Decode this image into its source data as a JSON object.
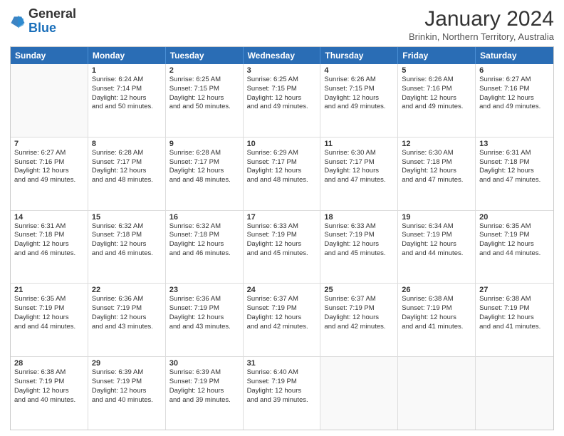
{
  "logo": {
    "line1": "General",
    "line2": "Blue"
  },
  "title": "January 2024",
  "subtitle": "Brinkin, Northern Territory, Australia",
  "header_days": [
    "Sunday",
    "Monday",
    "Tuesday",
    "Wednesday",
    "Thursday",
    "Friday",
    "Saturday"
  ],
  "weeks": [
    [
      {
        "day": "",
        "sunrise": "",
        "sunset": "",
        "daylight": ""
      },
      {
        "day": "1",
        "sunrise": "Sunrise: 6:24 AM",
        "sunset": "Sunset: 7:14 PM",
        "daylight": "Daylight: 12 hours and 50 minutes."
      },
      {
        "day": "2",
        "sunrise": "Sunrise: 6:25 AM",
        "sunset": "Sunset: 7:15 PM",
        "daylight": "Daylight: 12 hours and 50 minutes."
      },
      {
        "day": "3",
        "sunrise": "Sunrise: 6:25 AM",
        "sunset": "Sunset: 7:15 PM",
        "daylight": "Daylight: 12 hours and 49 minutes."
      },
      {
        "day": "4",
        "sunrise": "Sunrise: 6:26 AM",
        "sunset": "Sunset: 7:15 PM",
        "daylight": "Daylight: 12 hours and 49 minutes."
      },
      {
        "day": "5",
        "sunrise": "Sunrise: 6:26 AM",
        "sunset": "Sunset: 7:16 PM",
        "daylight": "Daylight: 12 hours and 49 minutes."
      },
      {
        "day": "6",
        "sunrise": "Sunrise: 6:27 AM",
        "sunset": "Sunset: 7:16 PM",
        "daylight": "Daylight: 12 hours and 49 minutes."
      }
    ],
    [
      {
        "day": "7",
        "sunrise": "Sunrise: 6:27 AM",
        "sunset": "Sunset: 7:16 PM",
        "daylight": "Daylight: 12 hours and 49 minutes."
      },
      {
        "day": "8",
        "sunrise": "Sunrise: 6:28 AM",
        "sunset": "Sunset: 7:17 PM",
        "daylight": "Daylight: 12 hours and 48 minutes."
      },
      {
        "day": "9",
        "sunrise": "Sunrise: 6:28 AM",
        "sunset": "Sunset: 7:17 PM",
        "daylight": "Daylight: 12 hours and 48 minutes."
      },
      {
        "day": "10",
        "sunrise": "Sunrise: 6:29 AM",
        "sunset": "Sunset: 7:17 PM",
        "daylight": "Daylight: 12 hours and 48 minutes."
      },
      {
        "day": "11",
        "sunrise": "Sunrise: 6:30 AM",
        "sunset": "Sunset: 7:17 PM",
        "daylight": "Daylight: 12 hours and 47 minutes."
      },
      {
        "day": "12",
        "sunrise": "Sunrise: 6:30 AM",
        "sunset": "Sunset: 7:18 PM",
        "daylight": "Daylight: 12 hours and 47 minutes."
      },
      {
        "day": "13",
        "sunrise": "Sunrise: 6:31 AM",
        "sunset": "Sunset: 7:18 PM",
        "daylight": "Daylight: 12 hours and 47 minutes."
      }
    ],
    [
      {
        "day": "14",
        "sunrise": "Sunrise: 6:31 AM",
        "sunset": "Sunset: 7:18 PM",
        "daylight": "Daylight: 12 hours and 46 minutes."
      },
      {
        "day": "15",
        "sunrise": "Sunrise: 6:32 AM",
        "sunset": "Sunset: 7:18 PM",
        "daylight": "Daylight: 12 hours and 46 minutes."
      },
      {
        "day": "16",
        "sunrise": "Sunrise: 6:32 AM",
        "sunset": "Sunset: 7:18 PM",
        "daylight": "Daylight: 12 hours and 46 minutes."
      },
      {
        "day": "17",
        "sunrise": "Sunrise: 6:33 AM",
        "sunset": "Sunset: 7:19 PM",
        "daylight": "Daylight: 12 hours and 45 minutes."
      },
      {
        "day": "18",
        "sunrise": "Sunrise: 6:33 AM",
        "sunset": "Sunset: 7:19 PM",
        "daylight": "Daylight: 12 hours and 45 minutes."
      },
      {
        "day": "19",
        "sunrise": "Sunrise: 6:34 AM",
        "sunset": "Sunset: 7:19 PM",
        "daylight": "Daylight: 12 hours and 44 minutes."
      },
      {
        "day": "20",
        "sunrise": "Sunrise: 6:35 AM",
        "sunset": "Sunset: 7:19 PM",
        "daylight": "Daylight: 12 hours and 44 minutes."
      }
    ],
    [
      {
        "day": "21",
        "sunrise": "Sunrise: 6:35 AM",
        "sunset": "Sunset: 7:19 PM",
        "daylight": "Daylight: 12 hours and 44 minutes."
      },
      {
        "day": "22",
        "sunrise": "Sunrise: 6:36 AM",
        "sunset": "Sunset: 7:19 PM",
        "daylight": "Daylight: 12 hours and 43 minutes."
      },
      {
        "day": "23",
        "sunrise": "Sunrise: 6:36 AM",
        "sunset": "Sunset: 7:19 PM",
        "daylight": "Daylight: 12 hours and 43 minutes."
      },
      {
        "day": "24",
        "sunrise": "Sunrise: 6:37 AM",
        "sunset": "Sunset: 7:19 PM",
        "daylight": "Daylight: 12 hours and 42 minutes."
      },
      {
        "day": "25",
        "sunrise": "Sunrise: 6:37 AM",
        "sunset": "Sunset: 7:19 PM",
        "daylight": "Daylight: 12 hours and 42 minutes."
      },
      {
        "day": "26",
        "sunrise": "Sunrise: 6:38 AM",
        "sunset": "Sunset: 7:19 PM",
        "daylight": "Daylight: 12 hours and 41 minutes."
      },
      {
        "day": "27",
        "sunrise": "Sunrise: 6:38 AM",
        "sunset": "Sunset: 7:19 PM",
        "daylight": "Daylight: 12 hours and 41 minutes."
      }
    ],
    [
      {
        "day": "28",
        "sunrise": "Sunrise: 6:38 AM",
        "sunset": "Sunset: 7:19 PM",
        "daylight": "Daylight: 12 hours and 40 minutes."
      },
      {
        "day": "29",
        "sunrise": "Sunrise: 6:39 AM",
        "sunset": "Sunset: 7:19 PM",
        "daylight": "Daylight: 12 hours and 40 minutes."
      },
      {
        "day": "30",
        "sunrise": "Sunrise: 6:39 AM",
        "sunset": "Sunset: 7:19 PM",
        "daylight": "Daylight: 12 hours and 39 minutes."
      },
      {
        "day": "31",
        "sunrise": "Sunrise: 6:40 AM",
        "sunset": "Sunset: 7:19 PM",
        "daylight": "Daylight: 12 hours and 39 minutes."
      },
      {
        "day": "",
        "sunrise": "",
        "sunset": "",
        "daylight": ""
      },
      {
        "day": "",
        "sunrise": "",
        "sunset": "",
        "daylight": ""
      },
      {
        "day": "",
        "sunrise": "",
        "sunset": "",
        "daylight": ""
      }
    ]
  ]
}
